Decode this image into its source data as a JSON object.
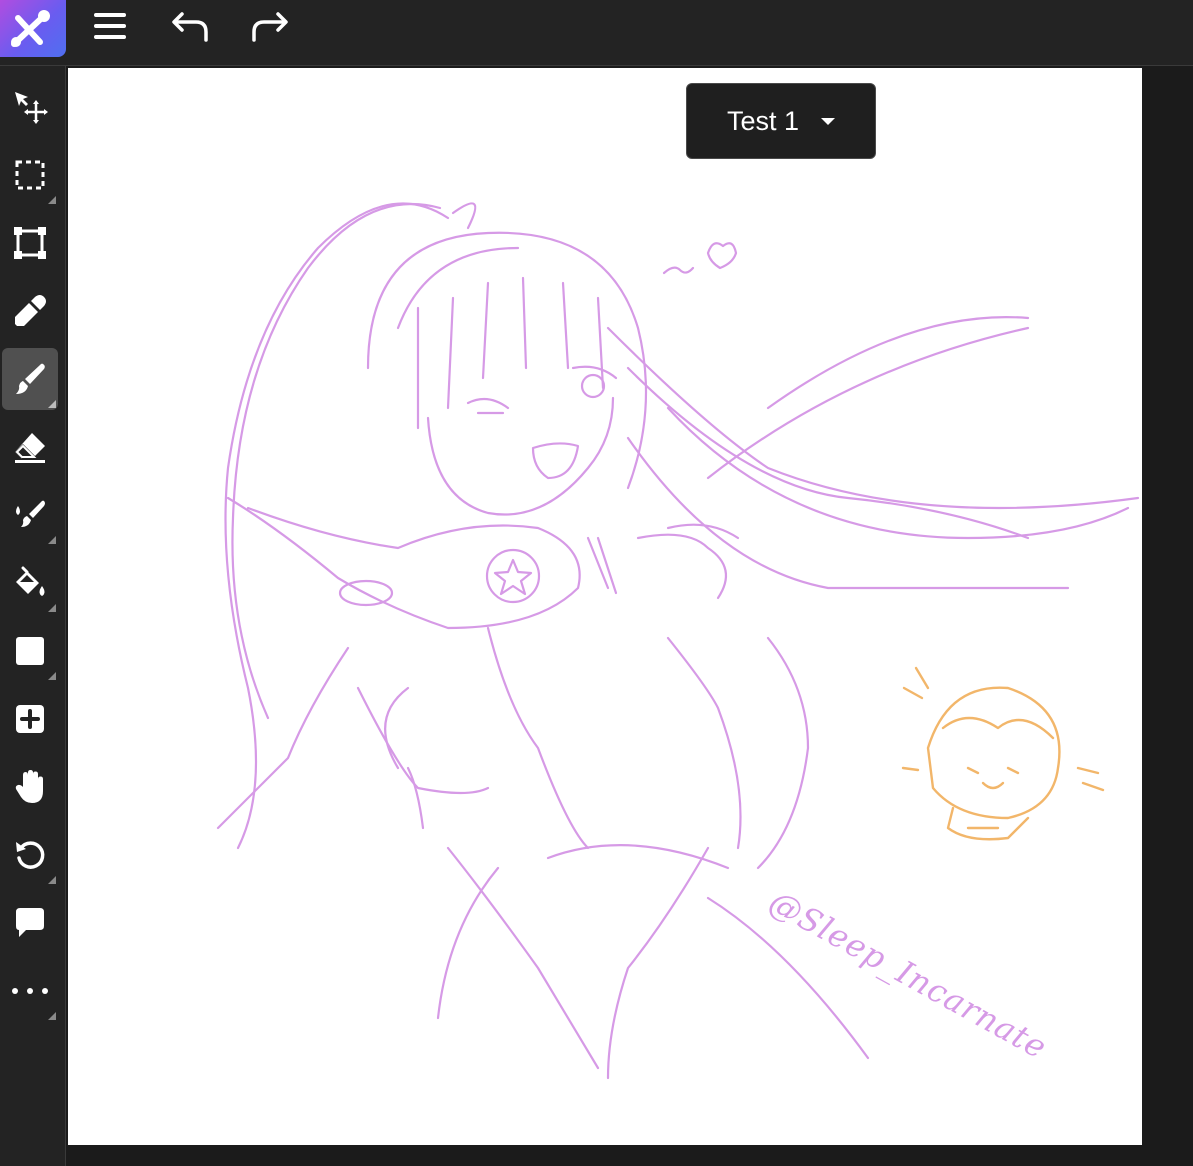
{
  "topbar": {
    "logo": "app-logo",
    "menu": "menu-icon",
    "undo": "undo-icon",
    "redo": "redo-icon"
  },
  "layer": {
    "name": "Test 1"
  },
  "tools": [
    {
      "name": "move-icon"
    },
    {
      "name": "selection-icon"
    },
    {
      "name": "transform-icon"
    },
    {
      "name": "eyedropper-icon"
    },
    {
      "name": "brush-icon",
      "active": true
    },
    {
      "name": "eraser-icon"
    },
    {
      "name": "smudge-icon"
    },
    {
      "name": "fill-icon"
    },
    {
      "name": "shape-icon"
    },
    {
      "name": "add-icon"
    },
    {
      "name": "hand-icon"
    },
    {
      "name": "rotate-icon"
    },
    {
      "name": "comment-icon"
    },
    {
      "name": "more-icon"
    }
  ],
  "artwork": {
    "signature": "@Sleep_Incarnate",
    "stroke_color": "#d69ae6",
    "accent_color": "#f2b66a"
  },
  "colors": {
    "bar": "#232323",
    "active_tool": "#505050",
    "paper": "#ffffff"
  }
}
